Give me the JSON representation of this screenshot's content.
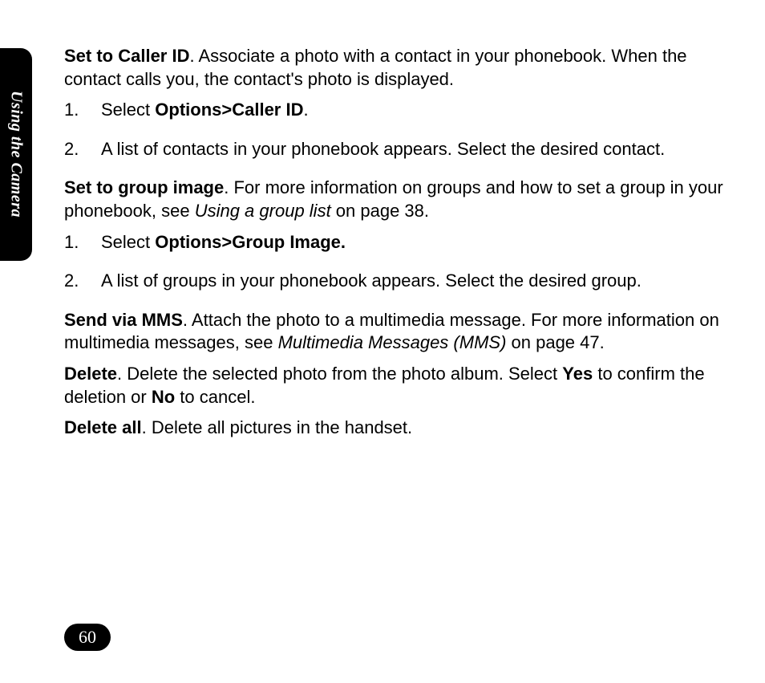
{
  "sideTab": "Using the Camera",
  "pageNumber": "60",
  "sections": {
    "callerId": {
      "title": "Set to Caller ID",
      "desc": ". Associate a photo with a contact in your phonebook. When the contact calls you, the contact's photo is displayed.",
      "step1_num": "1.",
      "step1_pre": "Select ",
      "step1_menu": "Options>Caller ID",
      "step1_post": ".",
      "step2_num": "2.",
      "step2_txt": " A list of contacts in your phonebook appears. Select the desired contact."
    },
    "groupImage": {
      "title": "Set to group image",
      "desc_a": ". For more information on groups and how to set a group in your phonebook, see ",
      "desc_italic": "Using a group list",
      "desc_b": " on page 38.",
      "step1_num": "1.",
      "step1_pre": "Select ",
      "step1_menu": "Options>Group Image.",
      "step2_num": "2.",
      "step2_txt": " A list of groups in your phonebook appears. Select the desired group."
    },
    "sendMms": {
      "title": "Send via MMS",
      "desc_a": ". Attach the photo to a multimedia message. For more information on multimedia messages, see ",
      "desc_italic": "Multimedia Messages (MMS)",
      "desc_b": "  on page 47."
    },
    "delete": {
      "title": "Delete",
      "a": ". Delete the selected photo from the photo album. Select ",
      "yes": "Yes",
      "b": " to confirm the deletion or ",
      "no": "No",
      "c": " to cancel."
    },
    "deleteAll": {
      "title": "Delete all",
      "desc": ". Delete all pictures in the handset."
    }
  }
}
